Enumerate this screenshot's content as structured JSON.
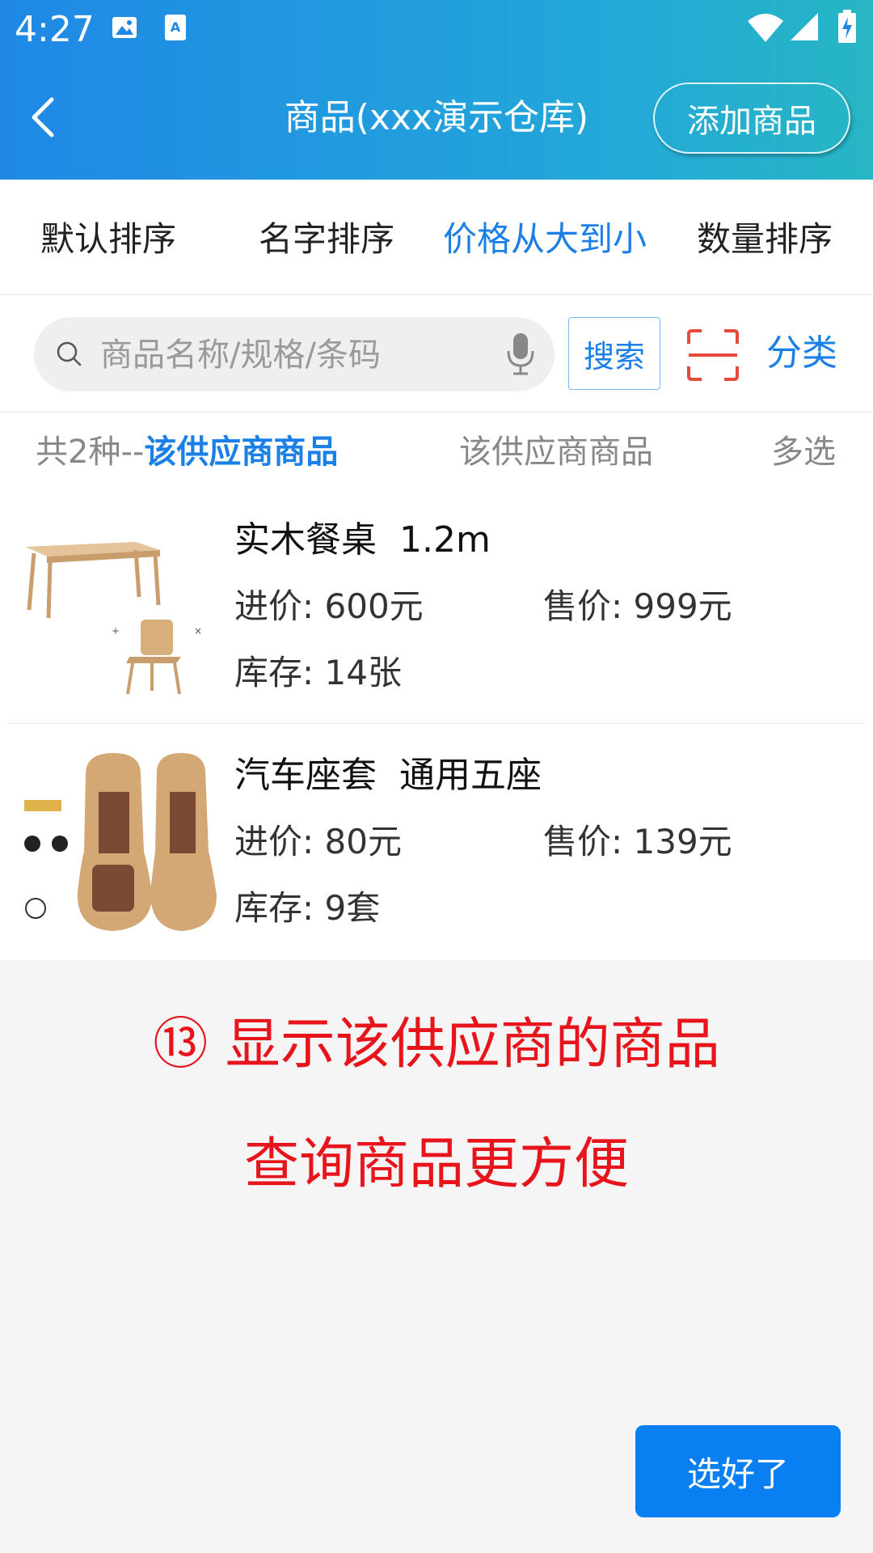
{
  "status_bar": {
    "time": "4:27"
  },
  "header": {
    "title": "商品(xxx演示仓库)",
    "add_button": "添加商品"
  },
  "sort_tabs": [
    {
      "label": "默认排序",
      "active": false
    },
    {
      "label": "名字排序",
      "active": false
    },
    {
      "label": "价格从大到小",
      "active": true
    },
    {
      "label": "数量排序",
      "active": false
    }
  ],
  "search": {
    "placeholder": "商品名称/规格/条码",
    "button": "搜索",
    "category": "分类"
  },
  "info_bar": {
    "count_prefix": "共2种--",
    "count_highlight": "该供应商商品",
    "supplier_link": "该供应商商品",
    "multi_select": "多选"
  },
  "products": [
    {
      "name": "实木餐桌  1.2m",
      "cost": "进价: 600元",
      "price": "售价: 999元",
      "stock": "库存: 14张"
    },
    {
      "name": "汽车座套  通用五座",
      "cost": "进价: 80元",
      "price": "售价: 139元",
      "stock": "库存: 9套"
    }
  ],
  "promo": {
    "line1": "⑬ 显示该供应商的商品",
    "line2": "查询商品更方便"
  },
  "confirm_button": "选好了",
  "colors": {
    "accent": "#1a7fe6",
    "promo": "#e8141c",
    "confirm": "#0a7ff2"
  }
}
